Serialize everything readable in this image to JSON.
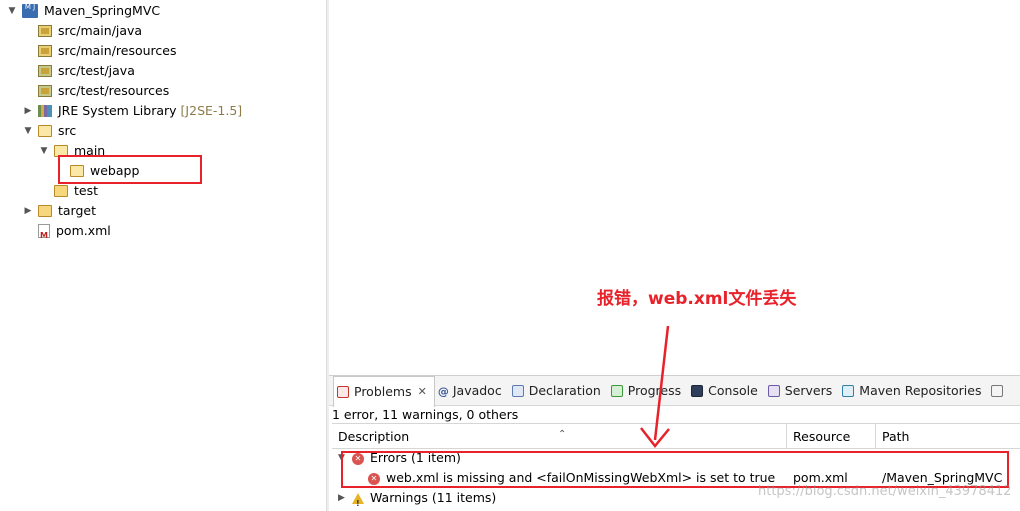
{
  "explorer": {
    "project": "Maven_SpringMVC",
    "items": [
      {
        "label": "src/main/java",
        "icon": "package-folder-icon"
      },
      {
        "label": "src/main/resources",
        "icon": "package-folder-icon"
      },
      {
        "label": "src/test/java",
        "icon": "test-package-folder-icon"
      },
      {
        "label": "src/test/resources",
        "icon": "test-package-folder-icon"
      },
      {
        "label": "JRE System Library",
        "suffix": "[J2SE-1.5]",
        "icon": "library-icon"
      },
      {
        "label": "src",
        "icon": "folder-icon"
      },
      {
        "label": "main",
        "icon": "folder-icon"
      },
      {
        "label": "webapp",
        "icon": "folder-icon"
      },
      {
        "label": "test",
        "icon": "folder-icon"
      },
      {
        "label": "target",
        "icon": "folder-icon"
      },
      {
        "label": "pom.xml",
        "icon": "maven-xml-icon"
      }
    ]
  },
  "annotation": {
    "text": "报错，web.xml文件丢失",
    "color": "#e8222a"
  },
  "problems": {
    "tabs": [
      {
        "label": "Problems",
        "close": "✕"
      },
      {
        "label": "Javadoc"
      },
      {
        "label": "Declaration"
      },
      {
        "label": "Progress"
      },
      {
        "label": "Console"
      },
      {
        "label": "Servers"
      },
      {
        "label": "Maven Repositories"
      }
    ],
    "summary": "1 error, 11 warnings, 0 others",
    "columns": [
      "Description",
      "Resource",
      "Path"
    ],
    "errors_group": "Errors (1 item)",
    "error_row": {
      "description": "web.xml is missing and <failOnMissingWebXml> is set to true",
      "resource": "pom.xml",
      "path": "/Maven_SpringMVC"
    },
    "warnings_group": "Warnings (11 items)"
  },
  "watermark": "https://blog.csdn.net/weixin_43978412",
  "colors": {
    "highlight": "#e8222a",
    "error": "#d9534f",
    "warning": "#e6b422"
  }
}
